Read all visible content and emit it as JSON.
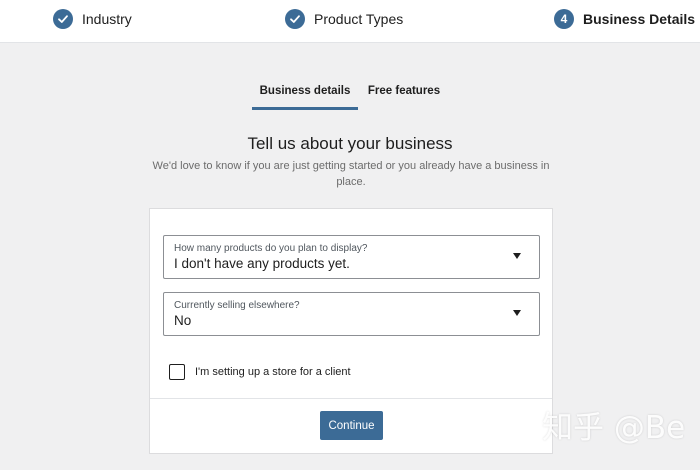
{
  "stepper": {
    "steps": [
      {
        "label": "Industry",
        "status": "completed",
        "badge": ""
      },
      {
        "label": "Product Types",
        "status": "completed",
        "badge": ""
      },
      {
        "label": "Business Details",
        "status": "active",
        "badge": "4"
      }
    ]
  },
  "tabs": [
    {
      "label": "Business details",
      "active": true
    },
    {
      "label": "Free features",
      "active": false
    }
  ],
  "main": {
    "heading": "Tell us about your business",
    "subtext": "We'd love to know if you are just getting started or you already have a business in place."
  },
  "form": {
    "products_select": {
      "label": "How many products do you plan to display?",
      "value": "I don't have any products yet."
    },
    "selling_select": {
      "label": "Currently selling elsewhere?",
      "value": "No"
    },
    "client_checkbox": {
      "label": "I'm setting up a store for a client",
      "checked": false
    },
    "continue_label": "Continue"
  },
  "watermark": {
    "text": "知乎 @Be"
  },
  "colors": {
    "accent": "#3c6b96",
    "background": "#f0f0f1",
    "card": "#ffffff",
    "text": "#1e1e1e",
    "muted_text": "#6c6c6c"
  }
}
